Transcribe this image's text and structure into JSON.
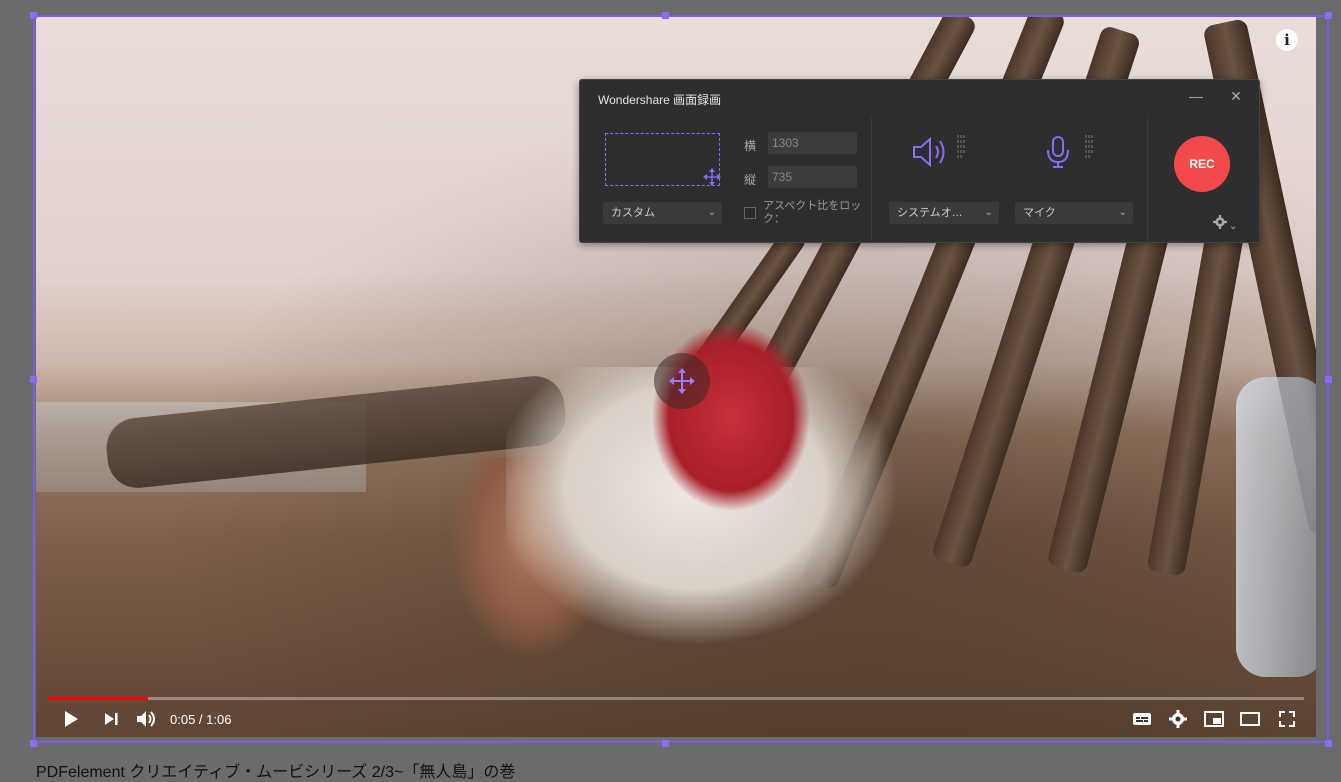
{
  "player": {
    "current_time": "0:05",
    "separator": " / ",
    "duration": "1:06",
    "progress_fraction": 0.08
  },
  "recorder": {
    "title": "Wondershare 画面録画",
    "width_label": "横",
    "width_value": "1303",
    "height_label": "縦",
    "height_value": "735",
    "area_mode": "カスタム",
    "aspect_lock_label": "アスペクト比をロック：",
    "system_audio": "システムオ…",
    "microphone": "マイク",
    "rec_label": "REC",
    "accent_color": "#8a6cf5",
    "rec_color": "#f24a4a"
  },
  "video_caption": "PDFelement クリエイティブ・ムービシリーズ 2/3~「無人島」の巻"
}
